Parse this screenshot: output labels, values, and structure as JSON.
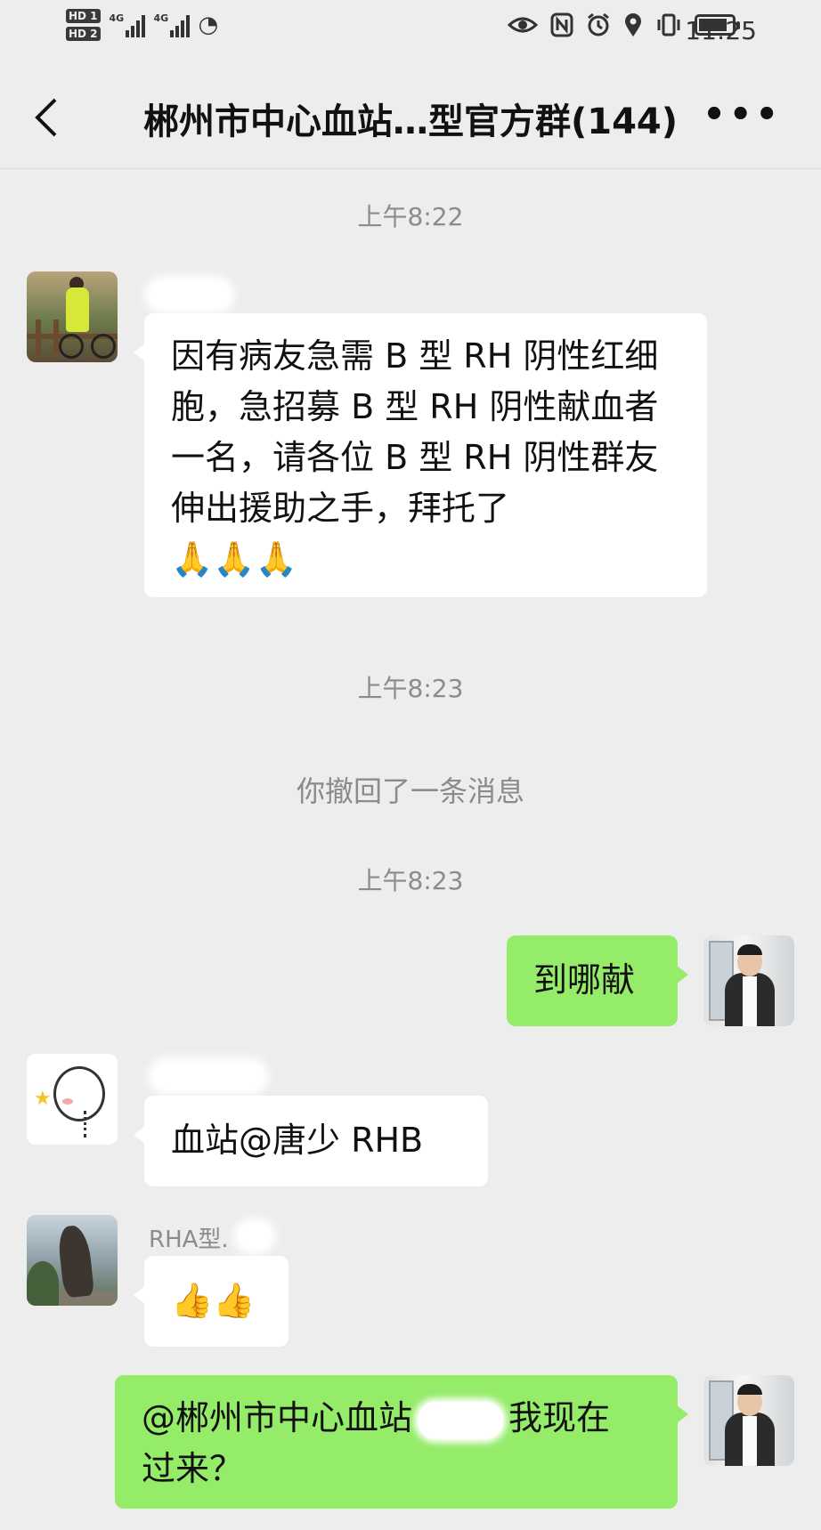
{
  "status_bar": {
    "hd1": "HD 1",
    "hd2": "HD 2",
    "net1": "4G",
    "net2": "4G",
    "time": "11:25",
    "battery_level": 0.85
  },
  "header": {
    "title": "郴州市中心血站…型官方群(144)"
  },
  "messages": {
    "time1": "上午8:22",
    "msg1_text": "因有病友急需 B 型 RH 阴性红细胞，急招募 B 型 RH 阴性献血者一名，请各位 B 型 RH 阴性群友伸出援助之手，拜托了",
    "msg1_emoji": "🙏🙏🙏",
    "time2": "上午8:23",
    "recall_notice": "你撤回了一条消息",
    "time3": "上午8:23",
    "msg2_text": "到哪献",
    "msg3_text": "血站@唐少 RHB",
    "msg4_sender": "RHA型.",
    "msg4_emoji": "👍👍",
    "msg5_part1": "@郴州市中心血站",
    "msg5_part2": "我现在",
    "msg5_part3": "过来？"
  }
}
